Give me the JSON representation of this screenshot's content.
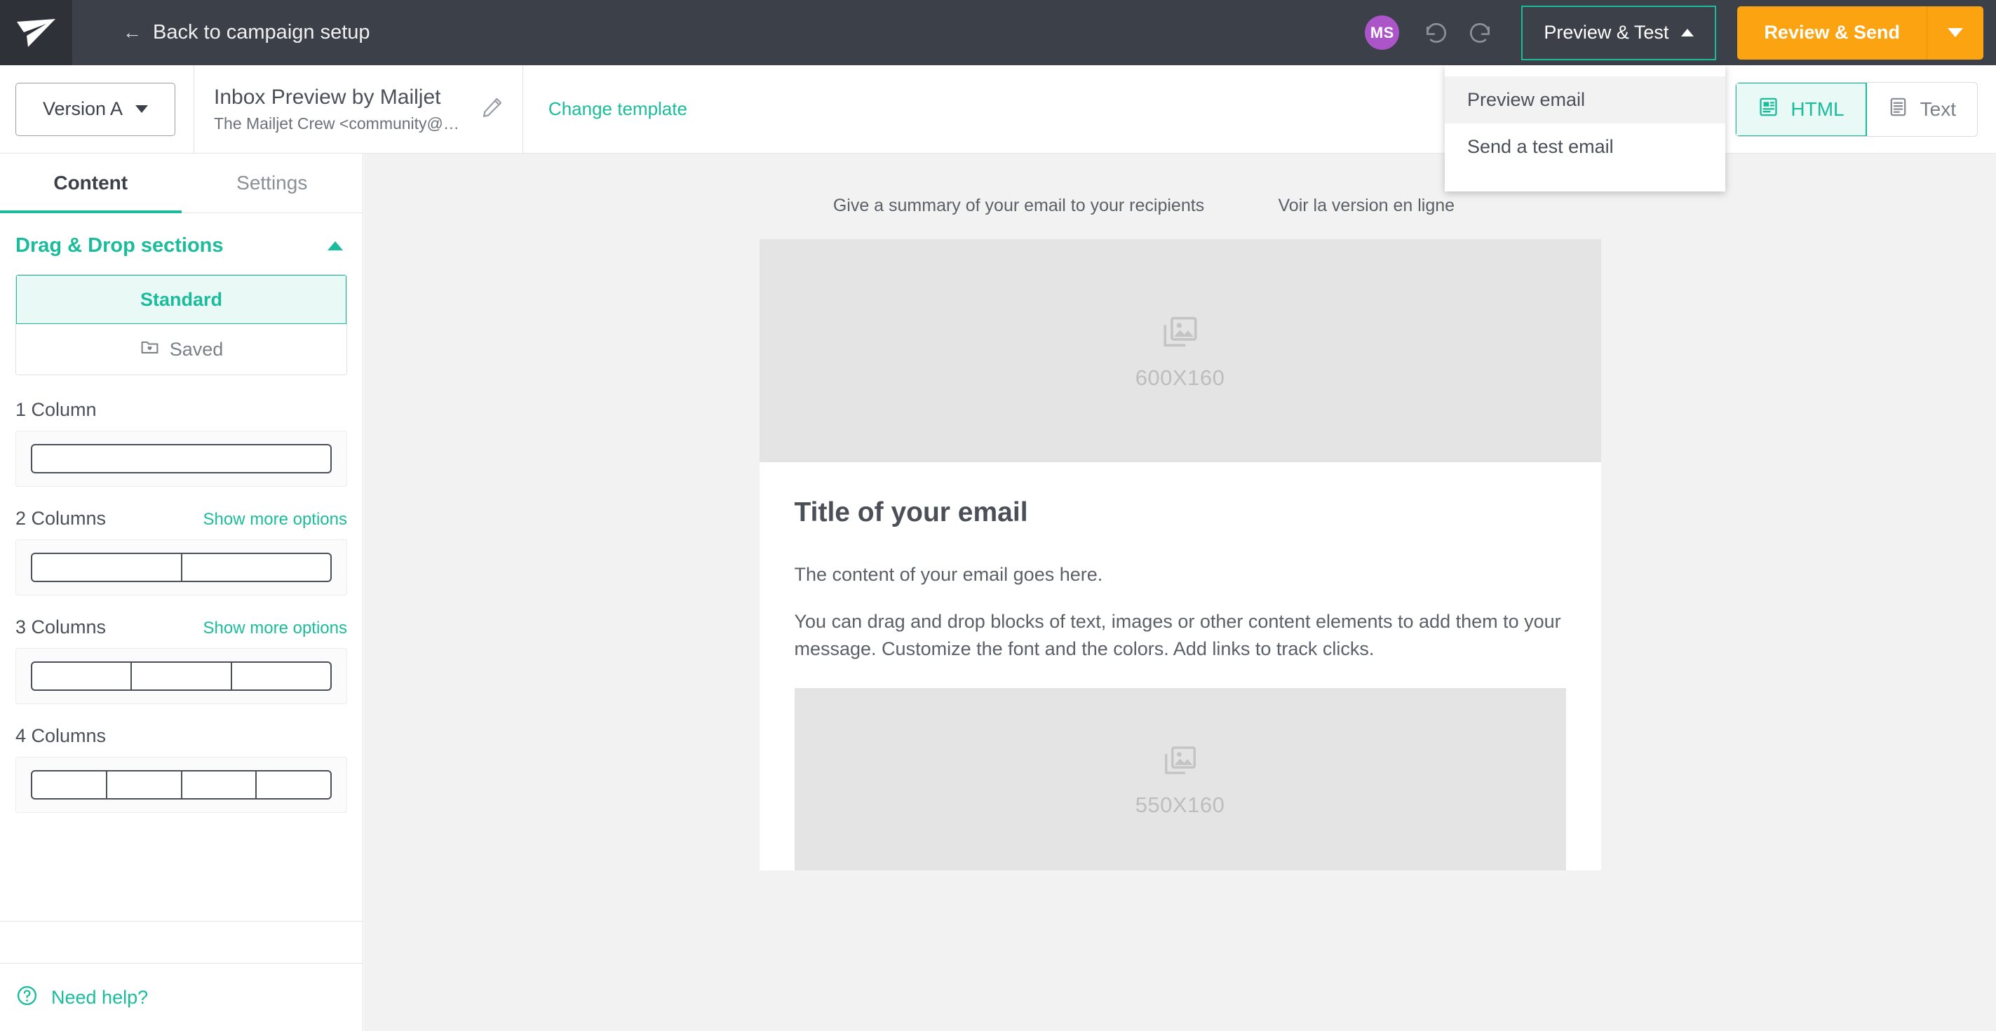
{
  "topbar": {
    "logo_icon": "paper-plane-logo-icon",
    "back_label": "Back to campaign setup",
    "back_arrow_icon": "arrow-left-icon",
    "avatar_initials": "MS",
    "undo_icon": "undo-icon",
    "redo_icon": "redo-icon",
    "preview_test_label": "Preview & Test",
    "preview_test_caret_icon": "caret-up-icon",
    "review_send_label": "Review & Send",
    "review_send_caret_icon": "caret-down-icon"
  },
  "dropdown": {
    "items": [
      {
        "label": "Preview email"
      },
      {
        "label": "Send a test email"
      }
    ]
  },
  "subbar": {
    "version_label": "Version A",
    "version_caret_icon": "caret-down-icon",
    "template_title": "Inbox Preview by Mailjet",
    "template_sender": "The Mailjet Crew <community@…",
    "edit_icon": "pencil-icon",
    "change_template_label": "Change template",
    "view_toggle": [
      {
        "label": "HTML",
        "icon": "html-document-icon",
        "active": true
      },
      {
        "label": "Text",
        "icon": "text-document-icon",
        "active": false
      }
    ]
  },
  "sidebar": {
    "tabs": [
      {
        "label": "Content",
        "active": true
      },
      {
        "label": "Settings",
        "active": false
      }
    ],
    "dragdrop": {
      "title": "Drag & Drop sections",
      "collapse_icon": "caret-up-icon",
      "segments": [
        {
          "label": "Standard",
          "active": true
        },
        {
          "label": "Saved",
          "icon": "saved-folder-icon",
          "active": false
        }
      ]
    },
    "column_groups": [
      {
        "label": "1 Column",
        "show_more": "",
        "cells": 1
      },
      {
        "label": "2 Columns",
        "show_more": "Show more options",
        "cells": 2
      },
      {
        "label": "3 Columns",
        "show_more": "Show more options",
        "cells": 3
      },
      {
        "label": "4 Columns",
        "show_more": "",
        "cells": 4
      }
    ],
    "need_help": {
      "label": "Need help?",
      "icon": "question-circle-icon"
    }
  },
  "email": {
    "preheader_summary": "Give a summary of your email to your recipients",
    "online_version_link": "Voir la version en ligne",
    "hero_placeholder": {
      "label": "600X160",
      "icon": "image-placeholder-icon"
    },
    "title": "Title of your email",
    "paragraphs": [
      "The content of your email goes here.",
      "You can drag and drop blocks of text, images or other content elements to add them to your message. Customize the font and the colors. Add links to track clicks."
    ],
    "second_placeholder": {
      "label": "550X160",
      "icon": "image-placeholder-icon"
    }
  },
  "colors": {
    "brand_green": "#1bbc9b",
    "topbar_dark": "#3c4049",
    "accent_orange": "#fca311",
    "avatar_purple": "#ab55c9"
  }
}
